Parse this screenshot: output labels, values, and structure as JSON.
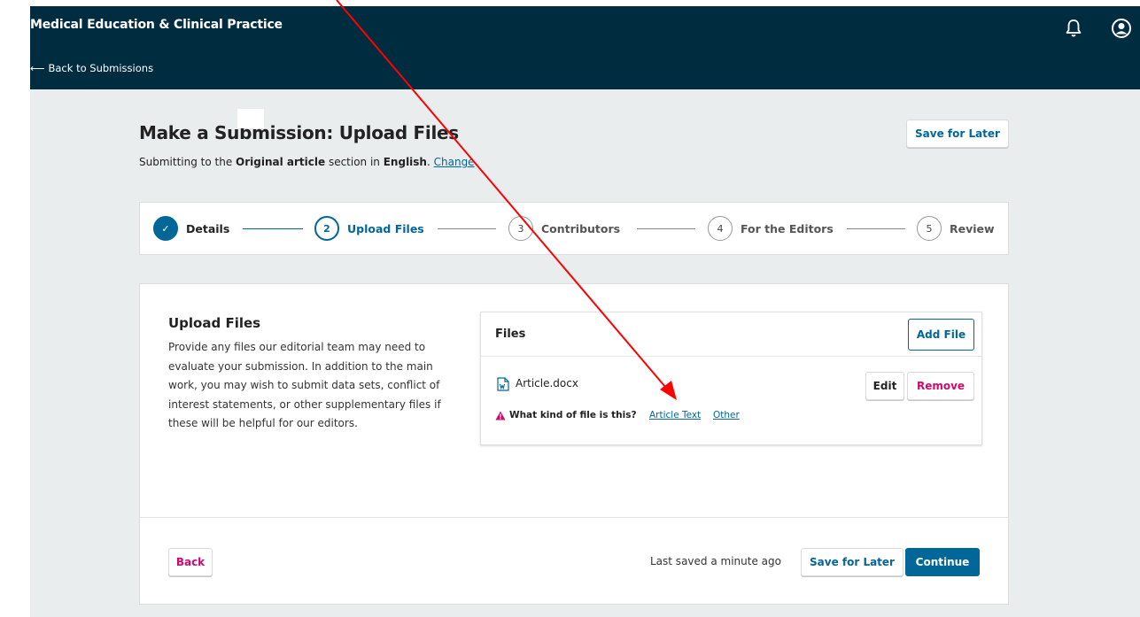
{
  "header": {
    "journal_name": "Medical Education & Clinical Practice",
    "back_label": "Back to Submissions",
    "back_arrow": "⟵",
    "icons": [
      "bell-icon",
      "user-icon"
    ]
  },
  "page": {
    "title": "Make a Submission: Upload Files",
    "subtitle_prefix": "Submitting to the ",
    "section_name": "Original article",
    "subtitle_mid": " section in ",
    "language": "English",
    "subtitle_end": ". ",
    "change_label": "Change",
    "save_for_later": "Save for Later"
  },
  "steps": [
    {
      "num": "✓",
      "label": "Details",
      "state": "done"
    },
    {
      "num": "2",
      "label": "Upload Files",
      "state": "current"
    },
    {
      "num": "3",
      "label": "Contributors",
      "state": "todo"
    },
    {
      "num": "4",
      "label": "For the Editors",
      "state": "todo"
    },
    {
      "num": "5",
      "label": "Review",
      "state": "todo"
    }
  ],
  "upload": {
    "title": "Upload Files",
    "description": "Provide any files our editorial team may need to evaluate your submission. In addition to the main work, you may wish to submit data sets, conflict of interest statements, or other supplementary files if these will be helpful for our editors."
  },
  "files_panel": {
    "label": "Files",
    "add_file": "Add File",
    "file": {
      "name": "Article.docx",
      "edit": "Edit",
      "remove": "Remove",
      "question": "What kind of file is this?",
      "options": [
        "Article Text",
        "Other"
      ]
    }
  },
  "footer": {
    "back": "Back",
    "saved": "Last saved a minute ago",
    "save_for_later": "Save for Later",
    "continue": "Continue"
  },
  "colors": {
    "header_bg": "#002c40",
    "primary": "#006798",
    "danger": "#d00a6c",
    "annotation": "#ff0000"
  }
}
